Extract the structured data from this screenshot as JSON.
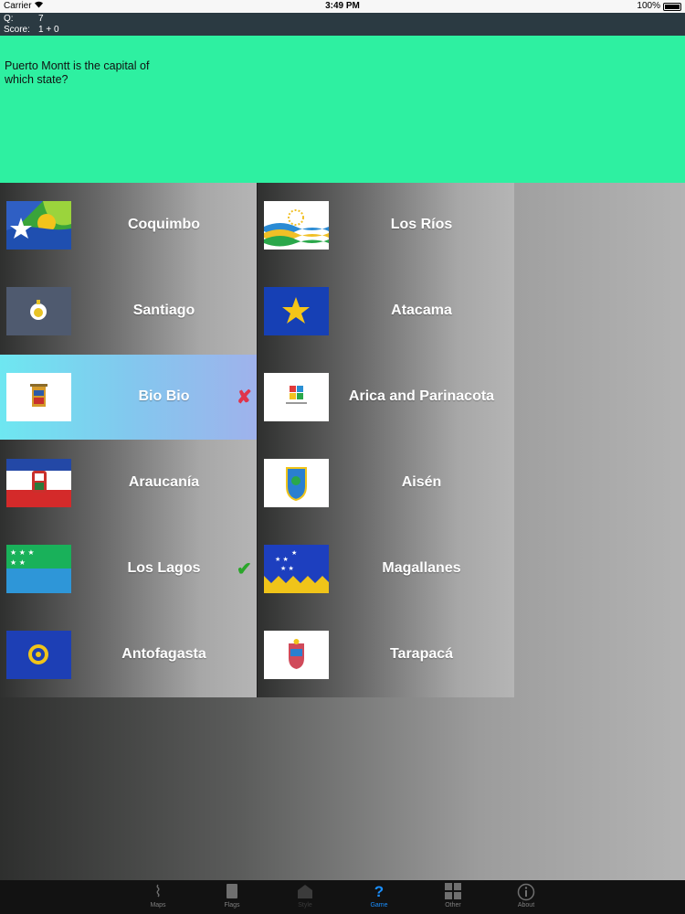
{
  "status_bar": {
    "carrier": "Carrier",
    "time": "3:49 PM",
    "battery": "100%"
  },
  "header": {
    "question_label": "Q:",
    "question_number": "7",
    "score_label": "Score:",
    "score_value": "1 + 0"
  },
  "question": {
    "text": "Puerto Montt is the capital of which state?"
  },
  "answers_left": [
    {
      "name": "Coquimbo",
      "flag": "coquimbo-flag",
      "state": "normal"
    },
    {
      "name": "Santiago",
      "flag": "santiago-flag",
      "state": "normal"
    },
    {
      "name": "Bio Bio",
      "flag": "biobio-flag",
      "state": "wrong",
      "mark": "✘"
    },
    {
      "name": "Araucanía",
      "flag": "araucania-flag",
      "state": "normal"
    },
    {
      "name": "Los Lagos",
      "flag": "loslagos-flag",
      "state": "correct",
      "mark": "✔"
    },
    {
      "name": "Antofagasta",
      "flag": "antofagasta-flag",
      "state": "normal"
    }
  ],
  "answers_right": [
    {
      "name": "Los Ríos",
      "flag": "losrios-flag",
      "state": "normal"
    },
    {
      "name": "Atacama",
      "flag": "atacama-flag",
      "state": "normal"
    },
    {
      "name": "Arica and Parinacota",
      "flag": "arica-flag",
      "state": "normal"
    },
    {
      "name": "Aisén",
      "flag": "aisen-flag",
      "state": "normal"
    },
    {
      "name": "Magallanes",
      "flag": "magallanes-flag",
      "state": "normal"
    },
    {
      "name": "Tarapacá",
      "flag": "tarapaca-flag",
      "state": "normal"
    }
  ],
  "tab_bar": {
    "tabs": [
      {
        "label": "Maps",
        "icon": "map-icon",
        "state": "normal"
      },
      {
        "label": "Flags",
        "icon": "flag-icon",
        "state": "normal"
      },
      {
        "label": "Style",
        "icon": "building-icon",
        "state": "dim"
      },
      {
        "label": "Game",
        "icon": "question-icon",
        "state": "active"
      },
      {
        "label": "Other",
        "icon": "grid-icon",
        "state": "normal"
      },
      {
        "label": "About",
        "icon": "info-icon",
        "state": "normal"
      }
    ]
  },
  "colors": {
    "question_bg": "#2ef0a1",
    "header_bg": "#2b3a42",
    "wrong_highlight": "#82c8ee",
    "correct_mark": "#2aa62a",
    "wrong_mark": "#e0344b",
    "active_tab": "#1a8fff"
  }
}
